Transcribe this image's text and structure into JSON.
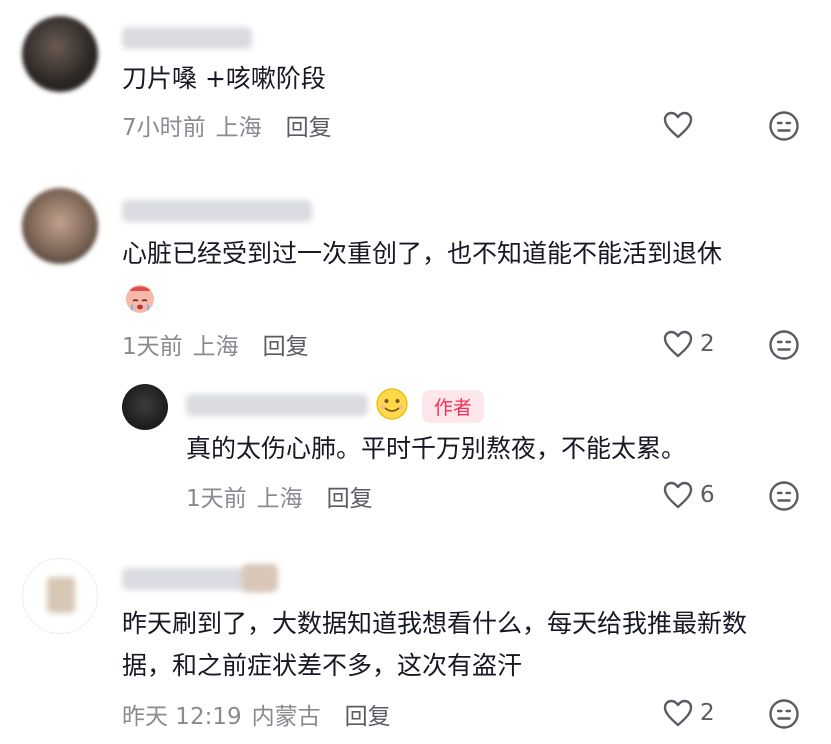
{
  "comments": [
    {
      "text": "刀片嗓 +咳嗽阶段",
      "time": "7小时前",
      "location": "上海",
      "reply_label": "回复",
      "likes": ""
    },
    {
      "text_line1": "心脏已经受到过一次重创了，也不知道能不能活到退休",
      "emoji": "crying-face-emoji",
      "time": "1天前",
      "location": "上海",
      "reply_label": "回复",
      "likes": "2",
      "reply": {
        "badge": "作者",
        "text": "真的太伤心肺。平时千万别熬夜，不能太累。",
        "time": "1天前",
        "location": "上海",
        "reply_label": "回复",
        "likes": "6"
      }
    },
    {
      "text_line1": "昨天刷到了，大数据知道我想看什么，每天给我推最新数",
      "text_line2": "据，和之前症状差不多，这次有盗汗",
      "time": "昨天 12:19",
      "location": "内蒙古",
      "reply_label": "回复",
      "likes": "2"
    }
  ],
  "icons": {
    "like": "heart-outline-icon",
    "dislike": "meh-face-icon"
  },
  "colors": {
    "text": "#161823",
    "meta": "#8a8b91",
    "badge_bg": "#fde7ea",
    "badge_fg": "#fe2c55"
  }
}
